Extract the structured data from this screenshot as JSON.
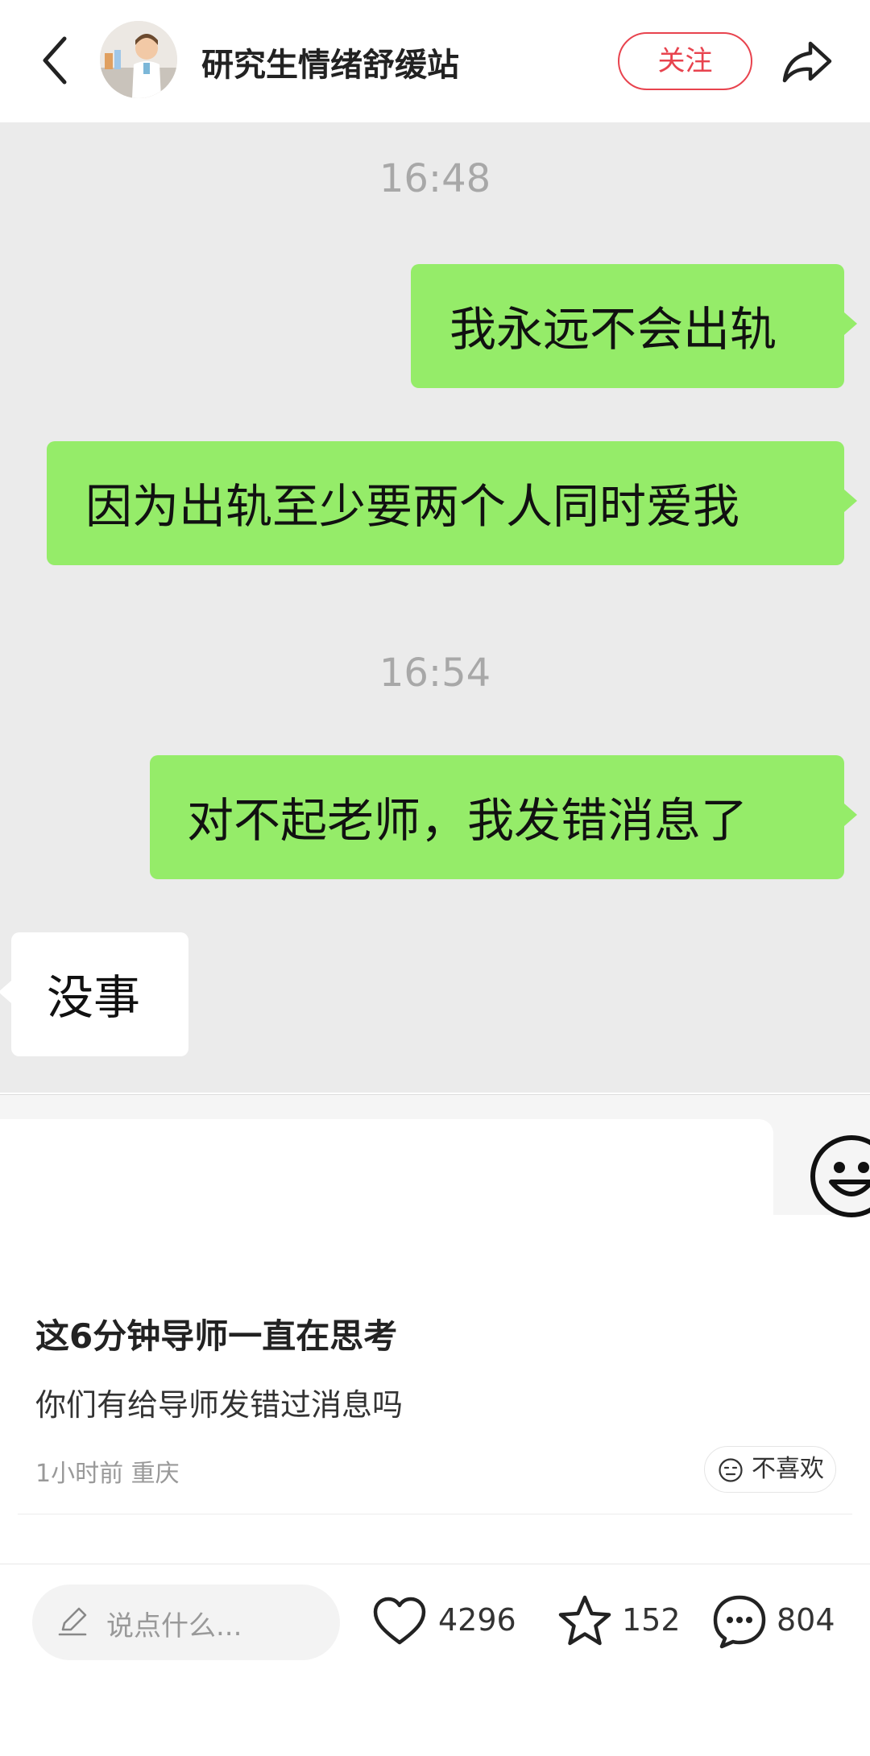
{
  "header": {
    "author_name": "研究生情绪舒缓站",
    "follow_label": "关注"
  },
  "chat": {
    "timestamps": [
      "16:48",
      "16:54"
    ],
    "messages": [
      {
        "side": "me",
        "text": "我永远不会出轨"
      },
      {
        "side": "me",
        "text": "因为出轨至少要两个人同时爱我"
      },
      {
        "side": "me",
        "text": "对不起老师，我发错消息了"
      },
      {
        "side": "other",
        "text": "没事"
      }
    ],
    "colors": {
      "background": "#ebebeb",
      "my_bubble": "#95ec69",
      "other_bubble": "#ffffff"
    }
  },
  "post": {
    "title": "这6分钟导师一直在思考",
    "body": "你们有给导师发错过消息吗",
    "meta": "1小时前 重庆",
    "dislike_label": "不喜欢"
  },
  "bottom_bar": {
    "comment_placeholder": "说点什么...",
    "likes": "4296",
    "collects": "152",
    "comments": "804"
  },
  "icons": [
    "back-arrow-icon",
    "share-icon",
    "emoji-icon",
    "dislike-face-icon",
    "pen-icon",
    "heart-icon",
    "star-icon",
    "comment-bubble-icon"
  ],
  "accent_color": "#e8434e"
}
